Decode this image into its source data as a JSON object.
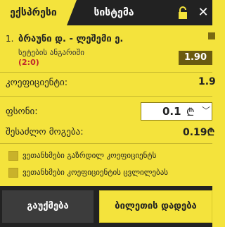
{
  "tabs": {
    "active": "ექსპრესი",
    "inactive": "სისტემა"
  },
  "header_icons": [
    "lock-icon",
    "close-icon"
  ],
  "bet": {
    "index": "1.",
    "match": "ბრაუნი დ. - ლეშემი ე.",
    "market": "სეტების ანგარიში",
    "score": "(2:0)",
    "odd": "1.90"
  },
  "coefficient": {
    "label": "კოეფიციენტი:",
    "value": "1.9"
  },
  "stake": {
    "label": "ფსონი:",
    "amount": "0.1",
    "currency": "₾"
  },
  "payout": {
    "label": "შესაძლო მოგება:",
    "value": "0.19",
    "currency": "₾"
  },
  "checkboxes": [
    {
      "label": "ვეთანხმები გაზრდილ კოეფიციენტს"
    },
    {
      "label": "ვეთანხმები კოეფიციენტის ცვლილებას"
    }
  ],
  "buttons": {
    "cancel": "გაუქმება",
    "place": "ბილეთის დადება"
  },
  "colors": {
    "accent": "#f4e33c",
    "dark": "#222222",
    "score": "#c0272d"
  }
}
